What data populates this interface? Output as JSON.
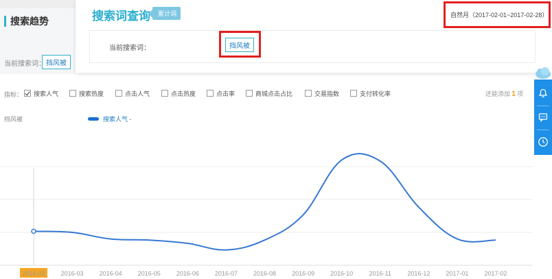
{
  "sidebar": {
    "section_title": "搜索趋势",
    "current_keyword_label": "当前搜索词：",
    "current_keyword": "挡风被"
  },
  "card": {
    "title": "搜索词查询",
    "badge": "累计词",
    "current_keyword_label": "当前搜索词：",
    "current_keyword": "挡风被",
    "date_range": "自然月（2017-02-01~2017-02-28）"
  },
  "indicators": {
    "label": "指标：",
    "items": [
      {
        "label": "搜索人气",
        "checked": true
      },
      {
        "label": "搜索热度",
        "checked": false
      },
      {
        "label": "点击人气",
        "checked": false
      },
      {
        "label": "点击热度",
        "checked": false
      },
      {
        "label": "点击率",
        "checked": false
      },
      {
        "label": "商城点击占比",
        "checked": false
      },
      {
        "label": "交易指数",
        "checked": false
      },
      {
        "label": "支付转化率",
        "checked": false
      }
    ],
    "remaining_prefix": "还能添加",
    "remaining_count": "1",
    "remaining_suffix": "项"
  },
  "legend": {
    "keyword": "挡风被",
    "series_label": "搜索人气 -"
  },
  "toolbar": {
    "icons": [
      "bell-icon",
      "chat-icon",
      "clock-icon"
    ]
  },
  "chart_data": {
    "type": "line",
    "categories": [
      "2016-02",
      "2016-03",
      "2016-04",
      "2016-05",
      "2016-06",
      "2016-07",
      "2016-08",
      "2016-09",
      "2016-10",
      "2016-11",
      "2016-12",
      "2017-01",
      "2017-02"
    ],
    "series": [
      {
        "values": [
          31,
          30,
          24,
          23,
          20,
          14,
          23,
          46,
          96,
          95,
          53,
          24,
          23
        ]
      }
    ],
    "ylim": [
      0,
      120
    ],
    "grid": true,
    "highlighted_category": "2016-02",
    "colors": {
      "line": "#3577d4",
      "highlight": "#f5a623"
    }
  }
}
